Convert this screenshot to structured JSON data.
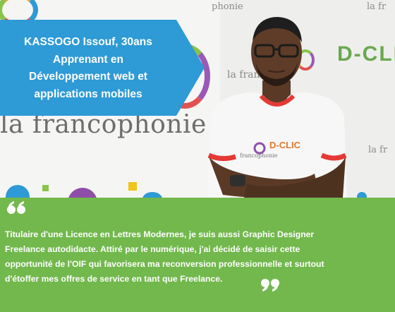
{
  "banner": {
    "name": "KASSOGO Issouf, 30ans",
    "line2": "Apprenant en",
    "line3": "Développement web et",
    "line4": "applications mobiles",
    "color": "#2e9ad6"
  },
  "backdrop": {
    "wordmark": "la francophonie",
    "brand_small_top": "phonie",
    "brand_small_right_top": "la fr",
    "brand_small_mid": "la franc",
    "brand_small_right_bottom": "la fr",
    "dclic_wall": "D-CLIC",
    "dclic_shirt": "D-CLIC",
    "shirt_brand": "francophonie"
  },
  "quote": {
    "line1": "Titulaire d'une Licence en Lettres Modernes, je suis aussi Graphic Designer",
    "line2": "Freelance autodidacte. Attiré par le numérique, j'ai décidé de saisir cette",
    "line3": "opportunité de l'OIF qui favorisera ma reconversion professionnelle et surtout",
    "line4": "d'étoffer mes offres de service en tant que Freelance.",
    "open_icon": "quote-open-icon",
    "close_icon": "quote-close-icon",
    "background": "#72b84d"
  }
}
